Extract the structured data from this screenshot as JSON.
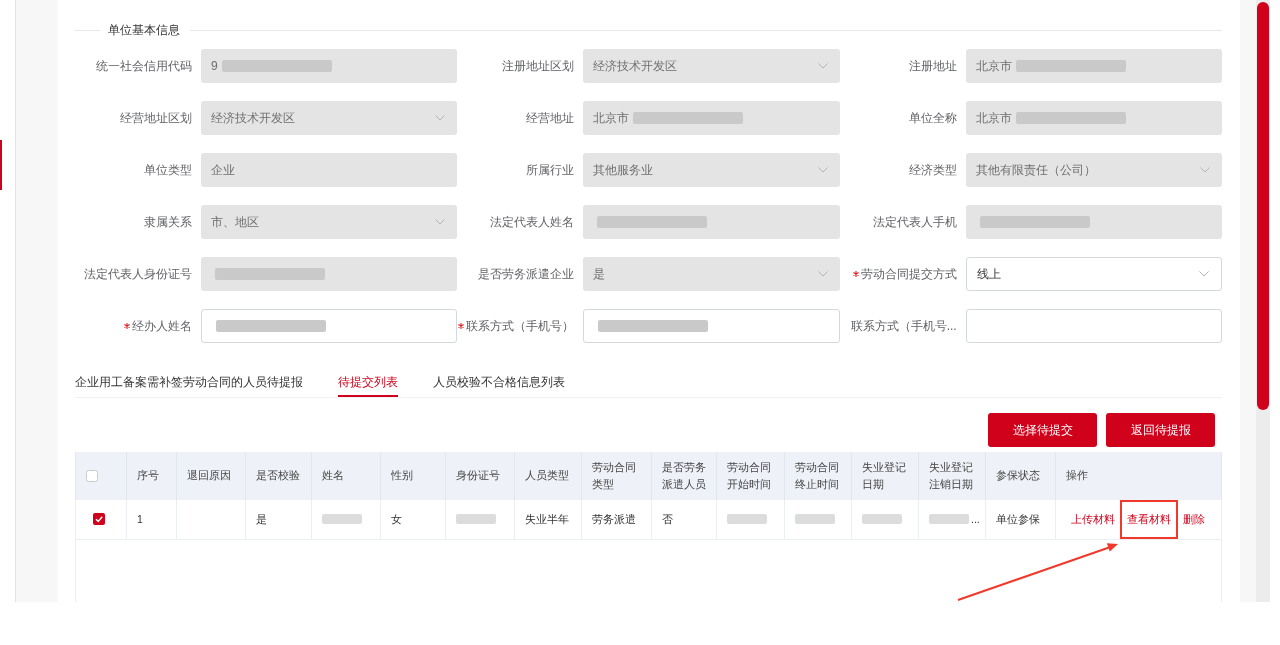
{
  "section": {
    "title": "单位基本信息"
  },
  "fields": [
    {
      "label": "统一社会信用代码",
      "kind": "text",
      "disabled": true,
      "required": false,
      "value": "9",
      "redacted": true
    },
    {
      "label": "注册地址区划",
      "kind": "select",
      "disabled": true,
      "required": false,
      "value": "经济技术开发区",
      "redacted": false
    },
    {
      "label": "注册地址",
      "kind": "text",
      "disabled": true,
      "required": false,
      "value": "北京市",
      "redacted": true
    },
    {
      "label": "经营地址区划",
      "kind": "select",
      "disabled": true,
      "required": false,
      "value": "经济技术开发区",
      "redacted": false
    },
    {
      "label": "经营地址",
      "kind": "text",
      "disabled": true,
      "required": false,
      "value": "北京市",
      "redacted": true
    },
    {
      "label": "单位全称",
      "kind": "text",
      "disabled": true,
      "required": false,
      "value": "北京市",
      "redacted": true
    },
    {
      "label": "单位类型",
      "kind": "text",
      "disabled": true,
      "required": false,
      "value": "企业",
      "redacted": false
    },
    {
      "label": "所属行业",
      "kind": "select",
      "disabled": true,
      "required": false,
      "value": "其他服务业",
      "redacted": false
    },
    {
      "label": "经济类型",
      "kind": "select",
      "disabled": true,
      "required": false,
      "value": "其他有限责任（公司）",
      "redacted": false
    },
    {
      "label": "隶属关系",
      "kind": "select",
      "disabled": true,
      "required": false,
      "value": "市、地区",
      "redacted": false
    },
    {
      "label": "法定代表人姓名",
      "kind": "text",
      "disabled": true,
      "required": false,
      "redacted": true
    },
    {
      "label": "法定代表人手机",
      "kind": "text",
      "disabled": true,
      "required": false,
      "redacted": true
    },
    {
      "label": "法定代表人身份证号",
      "kind": "text",
      "disabled": true,
      "required": false,
      "redacted": true
    },
    {
      "label": "是否劳务派遣企业",
      "kind": "select",
      "disabled": true,
      "required": false,
      "value": "是",
      "redacted": false
    },
    {
      "label": "劳动合同提交方式",
      "kind": "select",
      "disabled": false,
      "required": true,
      "value": "线上",
      "redacted": false
    },
    {
      "label": "经办人姓名",
      "kind": "text",
      "disabled": false,
      "required": true,
      "redacted": true
    },
    {
      "label": "联系方式（手机号）",
      "kind": "text",
      "disabled": false,
      "required": true,
      "redacted": true
    },
    {
      "label": "联系方式（手机号...",
      "kind": "text",
      "disabled": false,
      "required": false,
      "redacted": false
    }
  ],
  "tabs": [
    {
      "label": "企业用工备案需补签劳动合同的人员待提报",
      "selected": false
    },
    {
      "label": "待提交列表",
      "selected": true
    },
    {
      "label": "人员校验不合格信息列表",
      "selected": false
    }
  ],
  "buttons": [
    "选择待提交",
    "返回待提报"
  ],
  "table": {
    "select_all_checked": false,
    "columns": [
      "序号",
      "退回原因",
      "是否校验",
      "姓名",
      "性别",
      "身份证号",
      "人员类型",
      "劳动合同类型",
      "是否劳务派遣人员",
      "劳动合同开始时间",
      "劳动合同终止时间",
      "失业登记日期",
      "失业登记注销日期",
      "参保状态",
      "操作"
    ],
    "rows": [
      {
        "checked": true,
        "cells": [
          {
            "text": "1",
            "redacted": false
          },
          {
            "redacted": false
          },
          {
            "text": "是",
            "redacted": false
          },
          {
            "redacted": true
          },
          {
            "text": "女",
            "redacted": false
          },
          {
            "redacted": true
          },
          {
            "text": "失业半年",
            "redacted": false
          },
          {
            "text": "劳务派遣",
            "redacted": false
          },
          {
            "text": "否",
            "redacted": false
          },
          {
            "redacted": true
          },
          {
            "redacted": true
          },
          {
            "redacted": true
          },
          {
            "redacted": true,
            "suffix": "..."
          },
          {
            "text": "单位参保",
            "redacted": false
          }
        ],
        "actions": [
          {
            "label": "上传材料",
            "highlighted": false
          },
          {
            "label": "查看材料",
            "highlighted": true
          },
          {
            "label": "删除",
            "highlighted": false
          }
        ]
      }
    ]
  }
}
